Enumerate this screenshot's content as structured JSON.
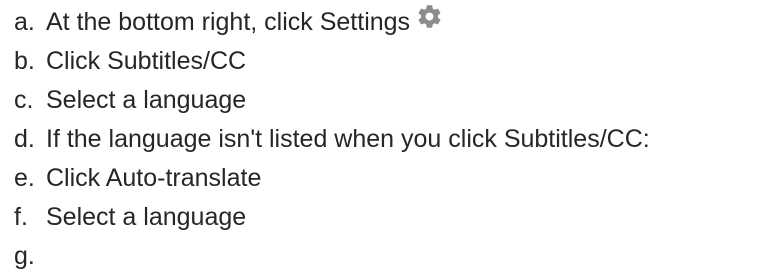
{
  "instructions": {
    "steps": [
      {
        "marker": "a.",
        "text": "At the bottom right, click Settings",
        "icon": "gear-icon"
      },
      {
        "marker": "b.",
        "text": "Click Subtitles/CC"
      },
      {
        "marker": "c.",
        "text": "Select a language"
      },
      {
        "marker": "d.",
        "text": "If the language isn't listed when you click Subtitles/CC:"
      },
      {
        "marker": "e.",
        "text": "Click Auto-translate"
      },
      {
        "marker": "f.",
        "text": "Select a language"
      },
      {
        "marker": "g.",
        "text": ""
      }
    ]
  },
  "colors": {
    "text": "#262626",
    "icon": "#8c8c8c"
  }
}
